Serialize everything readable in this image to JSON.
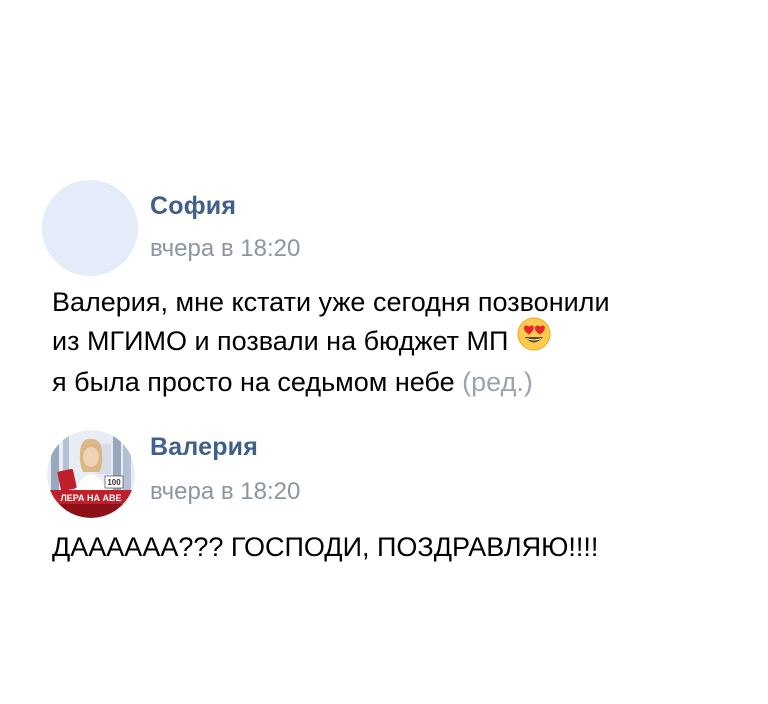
{
  "comments": [
    {
      "author": "София",
      "timestamp": "вчера в 18:20",
      "lines": [
        "Валерия, мне кстати уже сегодня позвонили",
        "из МГИМО и позвали на бюджет МП",
        "я была просто на седьмом небе"
      ],
      "emoji": "smiling-face-with-heart-eyes",
      "edited_label": "(ред.)"
    },
    {
      "author": "Валерия",
      "timestamp": "вчера в 18:20",
      "avatar_banner": "ЛЕРА НА АВЕ",
      "avatar_badge": "100",
      "lines": [
        "ДАААААА??? ГОСПОДИ, ПОЗДРАВЛЯЮ!!!!"
      ]
    }
  ]
}
